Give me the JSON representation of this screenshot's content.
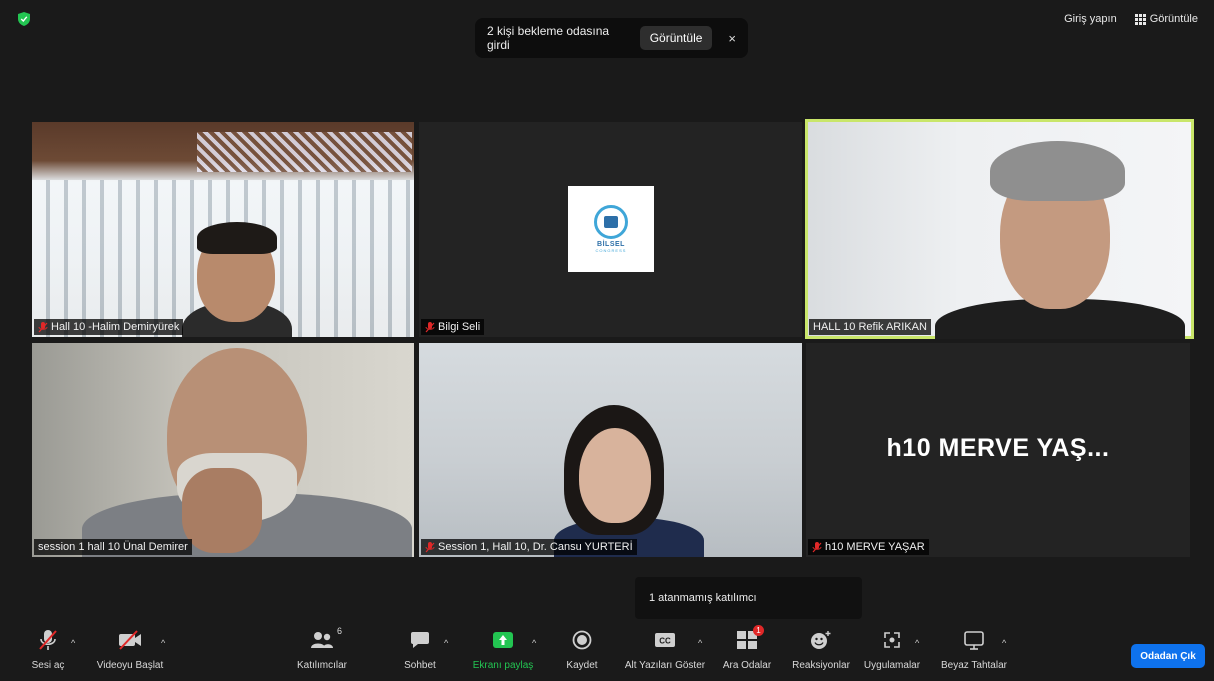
{
  "header": {
    "login_label": "Giriş yapın",
    "view_label": "Görüntüle"
  },
  "toast": {
    "message": "2 kişi bekleme odasına girdi",
    "view_label": "Görüntüle",
    "close_symbol": "×"
  },
  "tiles": [
    {
      "name": "Hall 10 -Halim Demiryürek",
      "muted": true
    },
    {
      "name": "Bilgi Seli",
      "muted": true
    },
    {
      "name": "HALL 10 Refik ARIKAN",
      "muted": false,
      "active": true
    },
    {
      "name": "session 1 hall 10 Ünal Demirer",
      "muted": false
    },
    {
      "name": "Session 1, Hall 10, Dr. Cansu YURTERİ",
      "muted": true
    },
    {
      "name": "h10 MERVE YAŞAR",
      "muted": true,
      "display_text": "h10 MERVE YAŞ..."
    }
  ],
  "logo": {
    "text": "BİLSEL",
    "sub": "CONGRESS"
  },
  "tooltip": {
    "text": "1 atanmamış katılımcı"
  },
  "toolbar": {
    "unmute": "Sesi aç",
    "start_video": "Videoyu Başlat",
    "participants": "Katılımcılar",
    "participants_count": "6",
    "chat": "Sohbet",
    "share_screen": "Ekranı paylaş",
    "record": "Kaydet",
    "captions": "Alt Yazıları Göster",
    "captions_icon_text": "CC",
    "breakout": "Ara Odalar",
    "breakout_badge": "1",
    "reactions": "Reaksiyonlar",
    "apps": "Uygulamalar",
    "whiteboards": "Beyaz Tahtalar",
    "leave": "Odadan Çık",
    "caret": "^"
  },
  "colors": {
    "background": "#1a1a1a",
    "active_speaker": "#c9e66a",
    "share_green": "#23c552",
    "leave_blue": "#0e72ed",
    "mute_red": "#e02828"
  }
}
